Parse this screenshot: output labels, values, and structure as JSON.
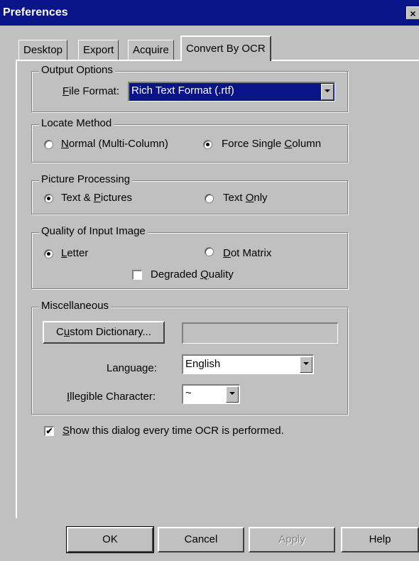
{
  "window": {
    "title": "Preferences",
    "close_glyph": "×"
  },
  "tabs": [
    {
      "label": "Desktop"
    },
    {
      "label": "Export"
    },
    {
      "label": "Acquire"
    },
    {
      "label": "Convert By OCR",
      "active": true
    }
  ],
  "output_options": {
    "legend": "Output Options",
    "file_format_label_pre": "",
    "file_format_label_acc": "F",
    "file_format_label_post": "ile Format:",
    "file_format_value": "Rich Text Format (.rtf)"
  },
  "locate_method": {
    "legend": "Locate Method",
    "normal_acc": "N",
    "normal_post": "ormal (Multi-Column)",
    "force_pre": "Force Single ",
    "force_acc": "C",
    "force_post": "olumn",
    "selected": "force_single_column"
  },
  "picture_processing": {
    "legend": "Picture Processing",
    "text_pictures_pre": "Text & ",
    "text_pictures_acc": "P",
    "text_pictures_post": "ictures",
    "text_only_pre": "Text ",
    "text_only_acc": "O",
    "text_only_post": "nly",
    "selected": "text_and_pictures"
  },
  "quality": {
    "legend": "Quality of Input Image",
    "letter_acc": "L",
    "letter_post": "etter",
    "dot_acc": "D",
    "dot_post": "ot Matrix",
    "degraded_pre": "Degraded ",
    "degraded_acc": "Q",
    "degraded_post": "uality",
    "selected": "letter",
    "degraded_checked": false
  },
  "misc": {
    "legend": "Miscellaneous",
    "custom_dict_pre": "C",
    "custom_dict_acc": "u",
    "custom_dict_post": "stom Dictionary...",
    "custom_dict_value": "",
    "language_label": "Language:",
    "language_value": "English",
    "illegible_acc": "I",
    "illegible_post": "llegible Character:",
    "illegible_value": "~"
  },
  "show_dialog": {
    "acc": "S",
    "post": "how this dialog every time OCR is performed.",
    "checked": true,
    "check_glyph": "✔"
  },
  "buttons": {
    "ok": "OK",
    "cancel": "Cancel",
    "apply": "Apply",
    "help": "Help"
  }
}
